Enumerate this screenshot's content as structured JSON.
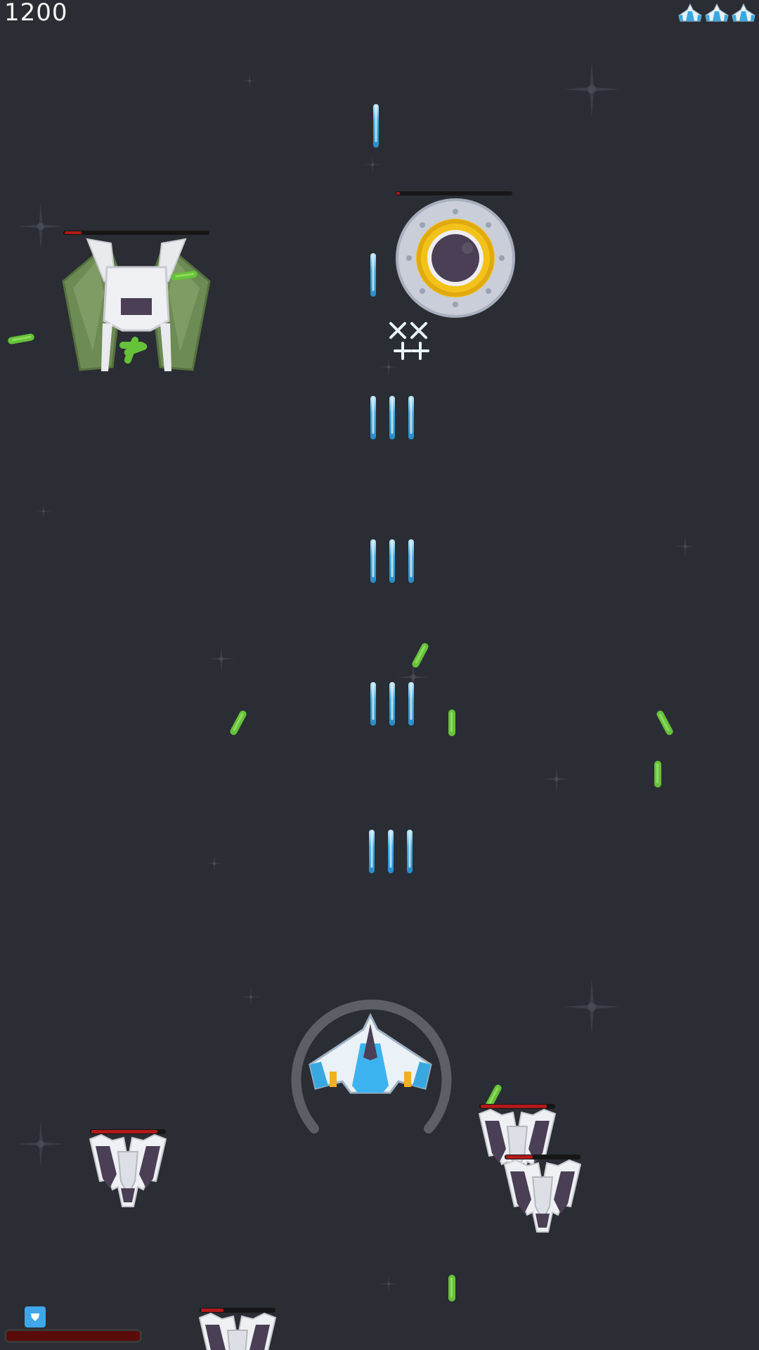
{
  "hud": {
    "score": "1200",
    "lives": 3,
    "power_level": 1.0,
    "shield_icon": "shield-icon"
  },
  "colors": {
    "background": "#2a2d33",
    "player_laser": "#3aa8e0",
    "enemy_laser": "#66c23a",
    "health_bar": "#b11a1a"
  },
  "sprites": {
    "player_ship": "player-fighter",
    "enemy_green": "green-mothership",
    "enemy_saucer": "orbital-saucer",
    "enemy_fighter": "white-grey-interceptor"
  },
  "enemy_health": {
    "green_mothership": 0.12,
    "orbital_saucer": 0.03,
    "interceptor_left": 0.9,
    "interceptor_right_a": 0.9,
    "interceptor_right_b": 0.35,
    "interceptor_bottom": 0.3
  }
}
